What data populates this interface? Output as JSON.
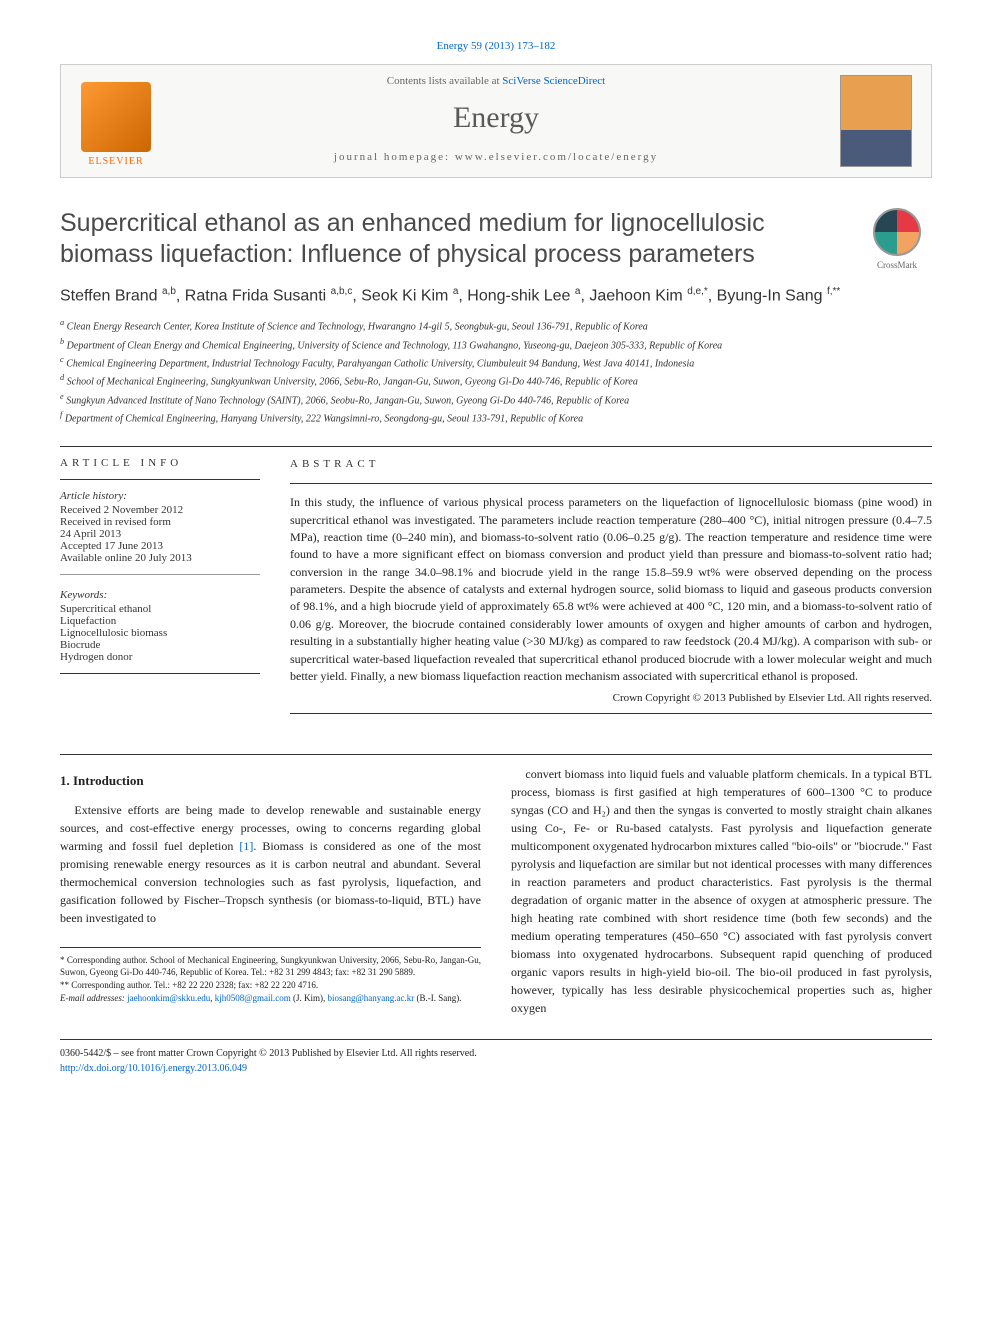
{
  "citation": "Energy 59 (2013) 173–182",
  "header": {
    "contents_prefix": "Contents lists available at ",
    "contents_link": "SciVerse ScienceDirect",
    "journal": "Energy",
    "homepage_prefix": "journal homepage: ",
    "homepage": "www.elsevier.com/locate/energy",
    "publisher": "ELSEVIER"
  },
  "crossmark": "CrossMark",
  "title": "Supercritical ethanol as an enhanced medium for lignocellulosic biomass liquefaction: Influence of physical process parameters",
  "authors_html": "Steffen Brand <sup>a,b</sup>, Ratna Frida Susanti <sup>a,b,c</sup>, Seok Ki Kim <sup>a</sup>, Hong-shik Lee <sup>a</sup>, Jaehoon Kim <sup>d,e,*</sup>, Byung-In Sang <sup>f,**</sup>",
  "affiliations": [
    "a Clean Energy Research Center, Korea Institute of Science and Technology, Hwarangno 14-gil 5, Seongbuk-gu, Seoul 136-791, Republic of Korea",
    "b Department of Clean Energy and Chemical Engineering, University of Science and Technology, 113 Gwahangno, Yuseong-gu, Daejeon 305-333, Republic of Korea",
    "c Chemical Engineering Department, Industrial Technology Faculty, Parahyangan Catholic University, Ciumbuleuit 94 Bandung, West Java 40141, Indonesia",
    "d School of Mechanical Engineering, Sungkyunkwan University, 2066, Sebu-Ro, Jangan-Gu, Suwon, Gyeong Gi-Do 440-746, Republic of Korea",
    "e Sungkyun Advanced Institute of Nano Technology (SAINT), 2066, Seobu-Ro, Jangan-Gu, Suwon, Gyeong Gi-Do 440-746, Republic of Korea",
    "f Department of Chemical Engineering, Hanyang University, 222 Wangsimni-ro, Seongdong-gu, Seoul 133-791, Republic of Korea"
  ],
  "article_info": {
    "heading": "ARTICLE INFO",
    "history_label": "Article history:",
    "history": [
      "Received 2 November 2012",
      "Received in revised form",
      "24 April 2013",
      "Accepted 17 June 2013",
      "Available online 20 July 2013"
    ],
    "keywords_label": "Keywords:",
    "keywords": [
      "Supercritical ethanol",
      "Liquefaction",
      "Lignocellulosic biomass",
      "Biocrude",
      "Hydrogen donor"
    ]
  },
  "abstract": {
    "heading": "ABSTRACT",
    "text": "In this study, the influence of various physical process parameters on the liquefaction of lignocellulosic biomass (pine wood) in supercritical ethanol was investigated. The parameters include reaction temperature (280–400 °C), initial nitrogen pressure (0.4–7.5 MPa), reaction time (0–240 min), and biomass-to-solvent ratio (0.06–0.25 g/g). The reaction temperature and residence time were found to have a more significant effect on biomass conversion and product yield than pressure and biomass-to-solvent ratio had; conversion in the range 34.0–98.1% and biocrude yield in the range 15.8–59.9 wt% were observed depending on the process parameters. Despite the absence of catalysts and external hydrogen source, solid biomass to liquid and gaseous products conversion of 98.1%, and a high biocrude yield of approximately 65.8 wt% were achieved at 400 °C, 120 min, and a biomass-to-solvent ratio of 0.06 g/g. Moreover, the biocrude contained considerably lower amounts of oxygen and higher amounts of carbon and hydrogen, resulting in a substantially higher heating value (>30 MJ/kg) as compared to raw feedstock (20.4 MJ/kg). A comparison with sub- or supercritical water-based liquefaction revealed that supercritical ethanol produced biocrude with a lower molecular weight and much better yield. Finally, a new biomass liquefaction reaction mechanism associated with supercritical ethanol is proposed.",
    "copyright": "Crown Copyright © 2013 Published by Elsevier Ltd. All rights reserved."
  },
  "body": {
    "section_num": "1.",
    "section_title": "Introduction",
    "p1": "Extensive efforts are being made to develop renewable and sustainable energy sources, and cost-effective energy processes, owing to concerns regarding global warming and fossil fuel depletion [1]. Biomass is considered as one of the most promising renewable energy resources as it is carbon neutral and abundant. Several thermochemical conversion technologies such as fast pyrolysis, liquefaction, and gasification followed by Fischer–Tropsch synthesis (or biomass-to-liquid, BTL) have been investigated to",
    "p2": "convert biomass into liquid fuels and valuable platform chemicals. In a typical BTL process, biomass is first gasified at high temperatures of 600–1300 °C to produce syngas (CO and H₂) and then the syngas is converted to mostly straight chain alkanes using Co-, Fe- or Ru-based catalysts. Fast pyrolysis and liquefaction generate multicomponent oxygenated hydrocarbon mixtures called \"bio-oils\" or \"biocrude.\" Fast pyrolysis and liquefaction are similar but not identical processes with many differences in reaction parameters and product characteristics. Fast pyrolysis is the thermal degradation of organic matter in the absence of oxygen at atmospheric pressure. The high heating rate combined with short residence time (both few seconds) and the medium operating temperatures (450–650 °C) associated with fast pyrolysis convert biomass into oxygenated hydrocarbons. Subsequent rapid quenching of produced organic vapors results in high-yield bio-oil. The bio-oil produced in fast pyrolysis, however, typically has less desirable physicochemical properties such as, higher oxygen"
  },
  "footnotes": {
    "corr1": "* Corresponding author. School of Mechanical Engineering, Sungkyunkwan University, 2066, Sebu-Ro, Jangan-Gu, Suwon, Gyeong Gi-Do 440-746, Republic of Korea. Tel.: +82 31 299 4843; fax: +82 31 290 5889.",
    "corr2": "** Corresponding author. Tel.: +82 22 220 2328; fax: +82 22 220 4716.",
    "emails_label": "E-mail addresses: ",
    "email1": "jaehoonkim@skku.edu",
    "email2": "kjh0508@gmail.com",
    "email1_who": " (J. Kim), ",
    "email3": "biosang@hanyang.ac.kr",
    "email3_who": " (B.-I. Sang)."
  },
  "footer": {
    "issn": "0360-5442/$ – see front matter Crown Copyright © 2013 Published by Elsevier Ltd. All rights reserved.",
    "doi_label": "",
    "doi": "http://dx.doi.org/10.1016/j.energy.2013.06.049"
  }
}
